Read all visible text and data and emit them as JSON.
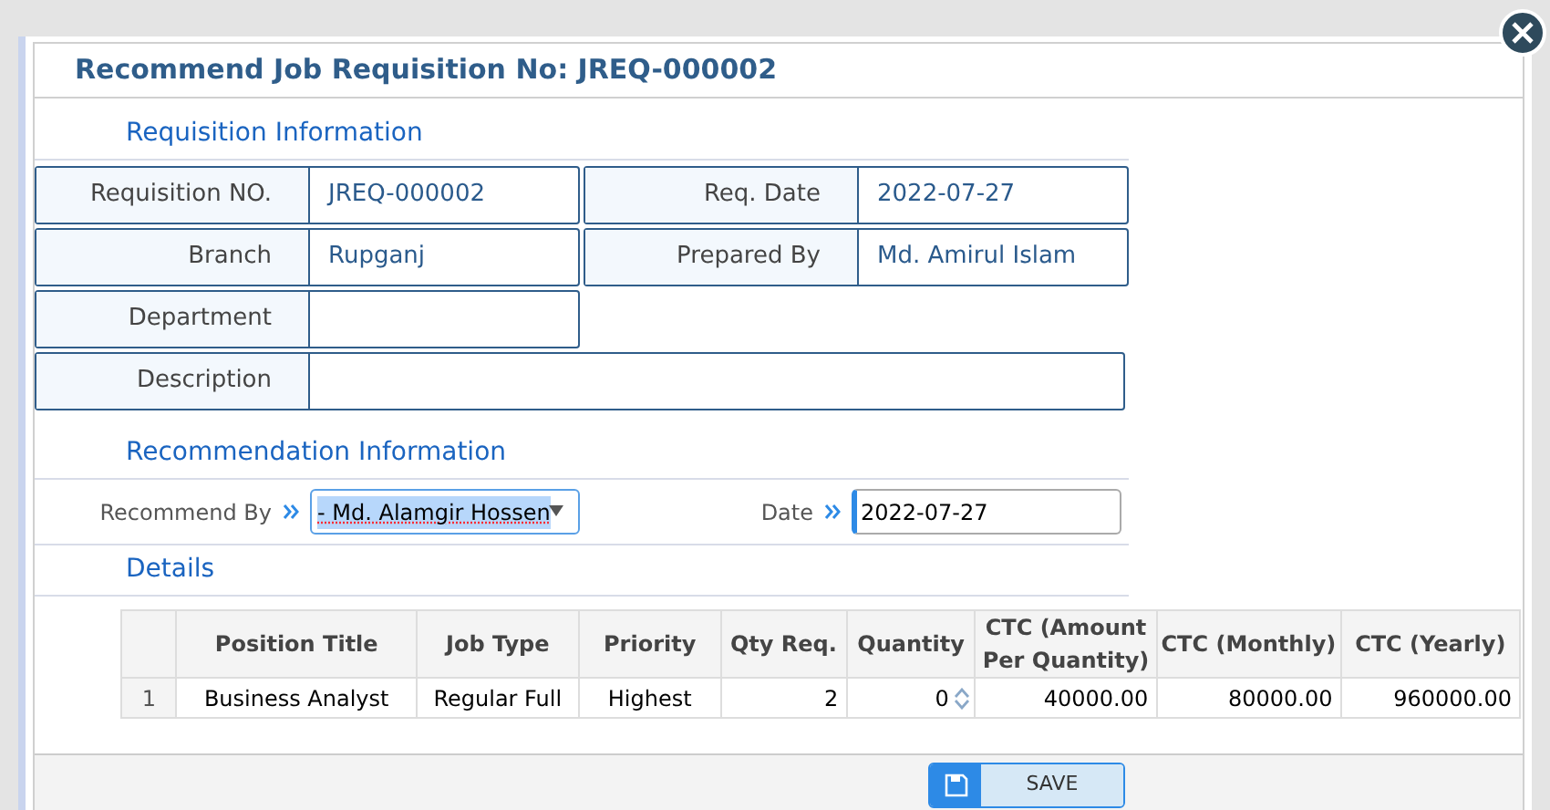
{
  "dialog": {
    "title": "Recommend Job Requisition No: JREQ-000002"
  },
  "requisition_information": {
    "heading": "Requisition Information",
    "rows": [
      [
        {
          "label": "Requisition NO.",
          "value": "JREQ-000002",
          "kind": "half"
        },
        {
          "label": "Req. Date",
          "value": "2022-07-27",
          "kind": "half"
        }
      ],
      [
        {
          "label": "Branch",
          "value": "Rupganj",
          "kind": "half"
        },
        {
          "label": "Prepared By",
          "value": "Md. Amirul Islam",
          "kind": "half"
        }
      ],
      [
        {
          "label": "Department",
          "kind": "half"
        }
      ],
      [
        {
          "label": "Description",
          "kind": "full"
        }
      ]
    ]
  },
  "recommendation_information": {
    "heading": "Recommendation Information",
    "fields": [
      {
        "label": "Recommend By",
        "kind": "select",
        "value": "- Md. Alamgir Hossen"
      },
      {
        "label": "Date",
        "kind": "date",
        "value": "2022-07-27"
      }
    ]
  },
  "details": {
    "heading": "Details",
    "columns": [
      {
        "label": "Position Title",
        "kind": "text"
      },
      {
        "label": "Job Type",
        "kind": "text"
      },
      {
        "label": "Priority",
        "kind": "text"
      },
      {
        "label": "Qty Req.",
        "kind": "number"
      },
      {
        "label": "Quantity",
        "kind": "spinner"
      },
      {
        "label": "CTC (Amount Per Quantity)",
        "kind": "number"
      },
      {
        "label": "CTC (Monthly)",
        "kind": "number"
      },
      {
        "label": "CTC (Yearly)",
        "kind": "number"
      }
    ],
    "rows": [
      {
        "index": "1",
        "cells": [
          "Business Analyst",
          "Regular Full",
          "Highest",
          "2",
          "0",
          "40000.00",
          "80000.00",
          "960000.00"
        ]
      }
    ]
  },
  "footer": {
    "save_button": "SAVE"
  }
}
